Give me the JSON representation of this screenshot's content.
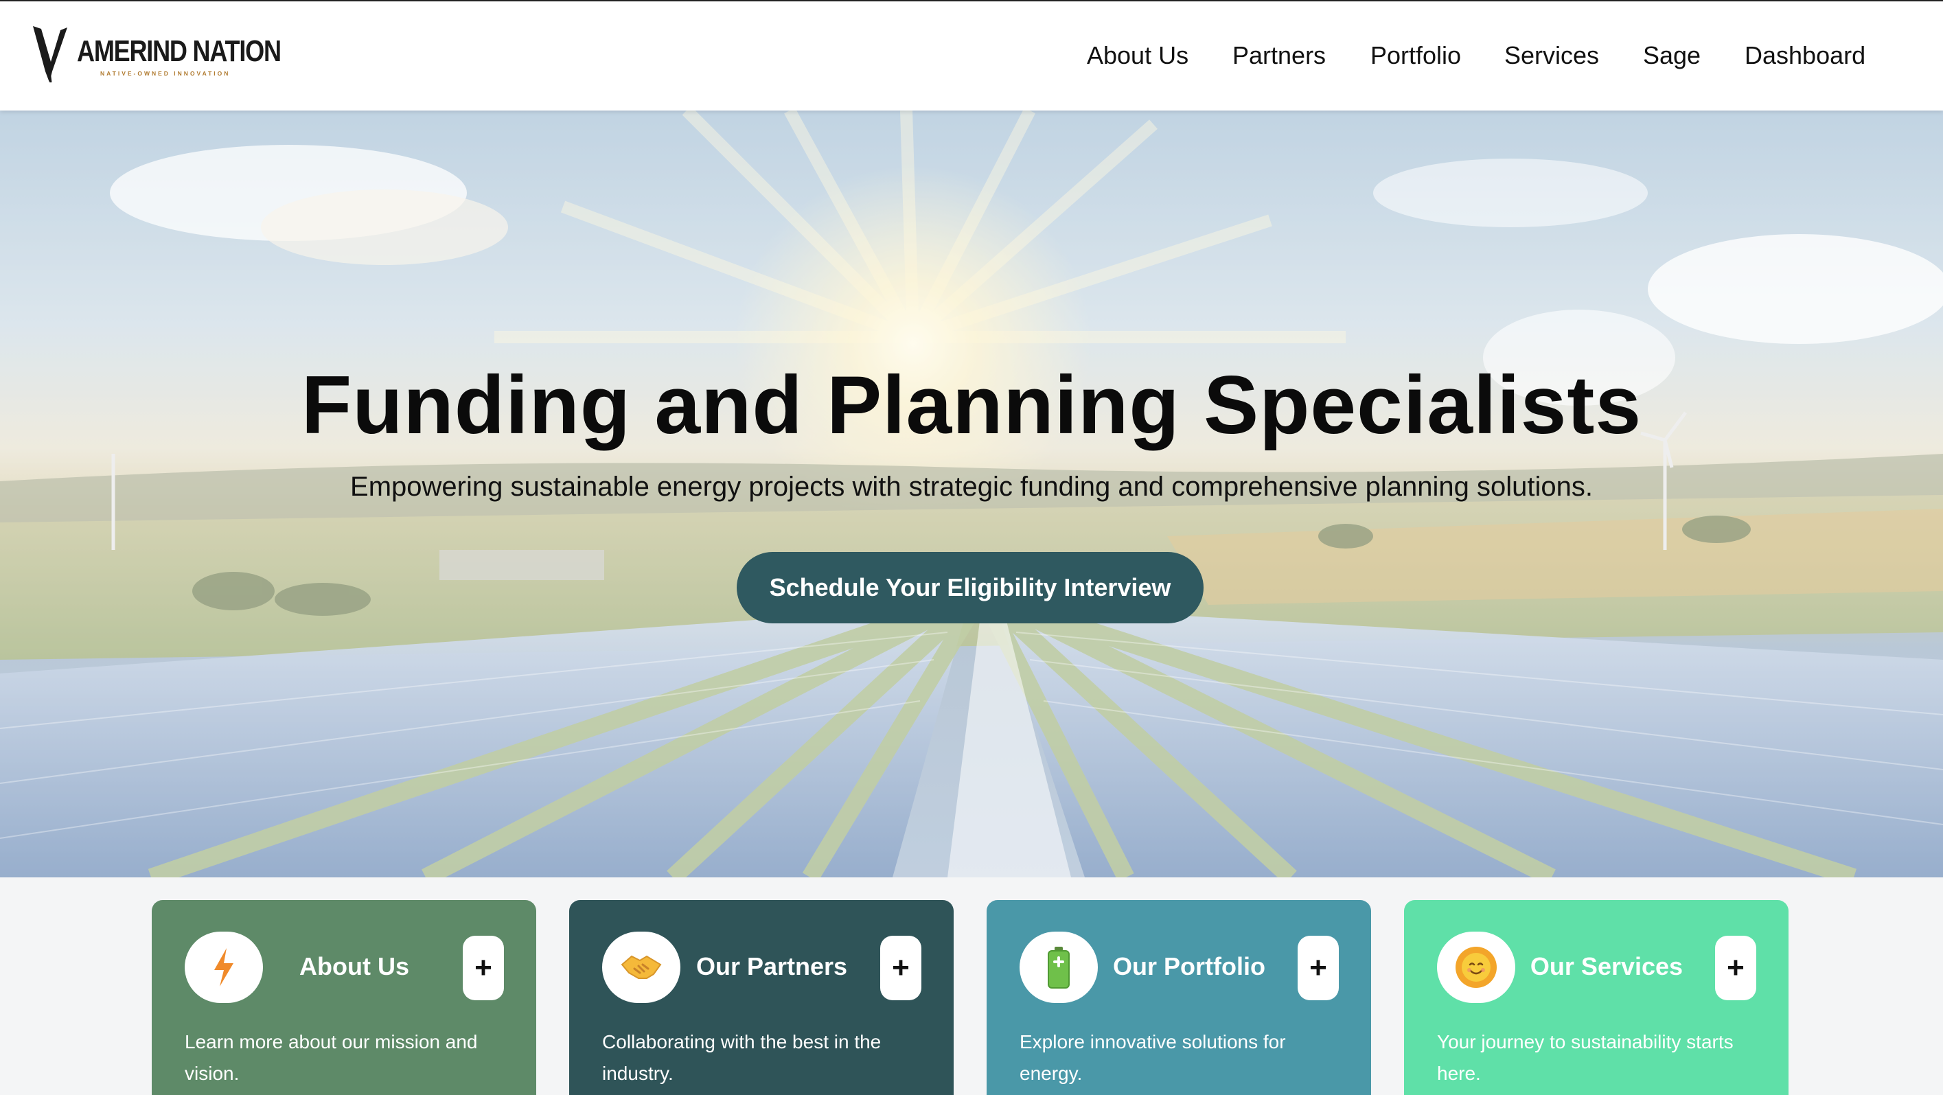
{
  "brand": {
    "name": "AMERIND NATION",
    "tagline": "NATIVE-OWNED INNOVATION"
  },
  "nav": {
    "items": [
      "About Us",
      "Partners",
      "Portfolio",
      "Services",
      "Sage",
      "Dashboard"
    ]
  },
  "hero": {
    "title": "Funding and Planning Specialists",
    "subtitle": "Empowering sustainable energy projects with strategic funding and comprehensive planning solutions.",
    "cta_label": "Schedule Your Eligibility Interview"
  },
  "cards": [
    {
      "title": "About Us",
      "description": "Learn more about our mission and vision.",
      "icon": "lightning-icon",
      "color": "#5e8a68"
    },
    {
      "title": "Our Partners",
      "description": "Collaborating with the best in the industry.",
      "icon": "handshake-icon",
      "color": "#2f5458"
    },
    {
      "title": "Our Portfolio",
      "description": "Explore innovative solutions for energy.",
      "icon": "battery-icon",
      "color": "#4a98a8"
    },
    {
      "title": "Our Services",
      "description": "Your journey to sustainability starts here.",
      "icon": "sun-icon",
      "color": "#5fe0a8"
    }
  ],
  "plus_symbol": "+",
  "colors": {
    "primary_button": "#2f5960",
    "accent_orange": "#f08a2a"
  }
}
